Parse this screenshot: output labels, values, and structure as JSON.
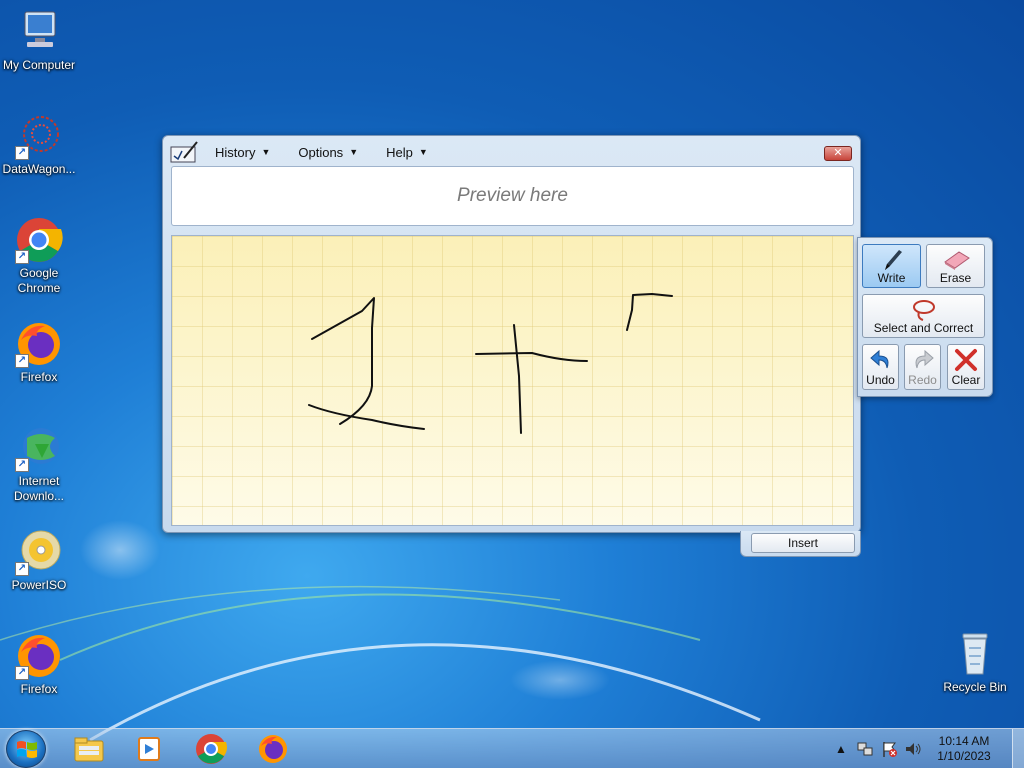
{
  "desktop": {
    "icons": [
      {
        "label": "My Computer",
        "icon": "computer-icon"
      },
      {
        "label": "DataWagon...",
        "icon": "datawagon-icon"
      },
      {
        "label": "Google Chrome",
        "icon": "chrome-icon"
      },
      {
        "label": "Firefox",
        "icon": "firefox-icon"
      },
      {
        "label": "Internet Downlo...",
        "icon": "idm-icon"
      },
      {
        "label": "PowerISO",
        "icon": "poweriso-icon"
      },
      {
        "label": "Firefox",
        "icon": "firefox-icon"
      },
      {
        "label": "Recycle Bin",
        "icon": "recycle-bin-icon"
      }
    ]
  },
  "tip": {
    "menu": [
      {
        "label": "History"
      },
      {
        "label": "Options"
      },
      {
        "label": "Help"
      }
    ],
    "close_label": "✕",
    "preview_text": "Preview here",
    "tools": {
      "write": "Write",
      "erase": "Erase",
      "select_correct": "Select and Correct",
      "undo": "Undo",
      "redo": "Redo",
      "clear": "Clear"
    },
    "insert_label": "Insert"
  },
  "taskbar": {
    "apps": [
      "explorer-icon",
      "media-player-icon",
      "chrome-icon",
      "firefox-icon"
    ],
    "clock": {
      "time": "10:14 AM",
      "date": "1/10/2023"
    }
  },
  "colors": {
    "accent": "#3d7bbf",
    "close": "#c7443a",
    "canvas": "#fdf6cf"
  }
}
